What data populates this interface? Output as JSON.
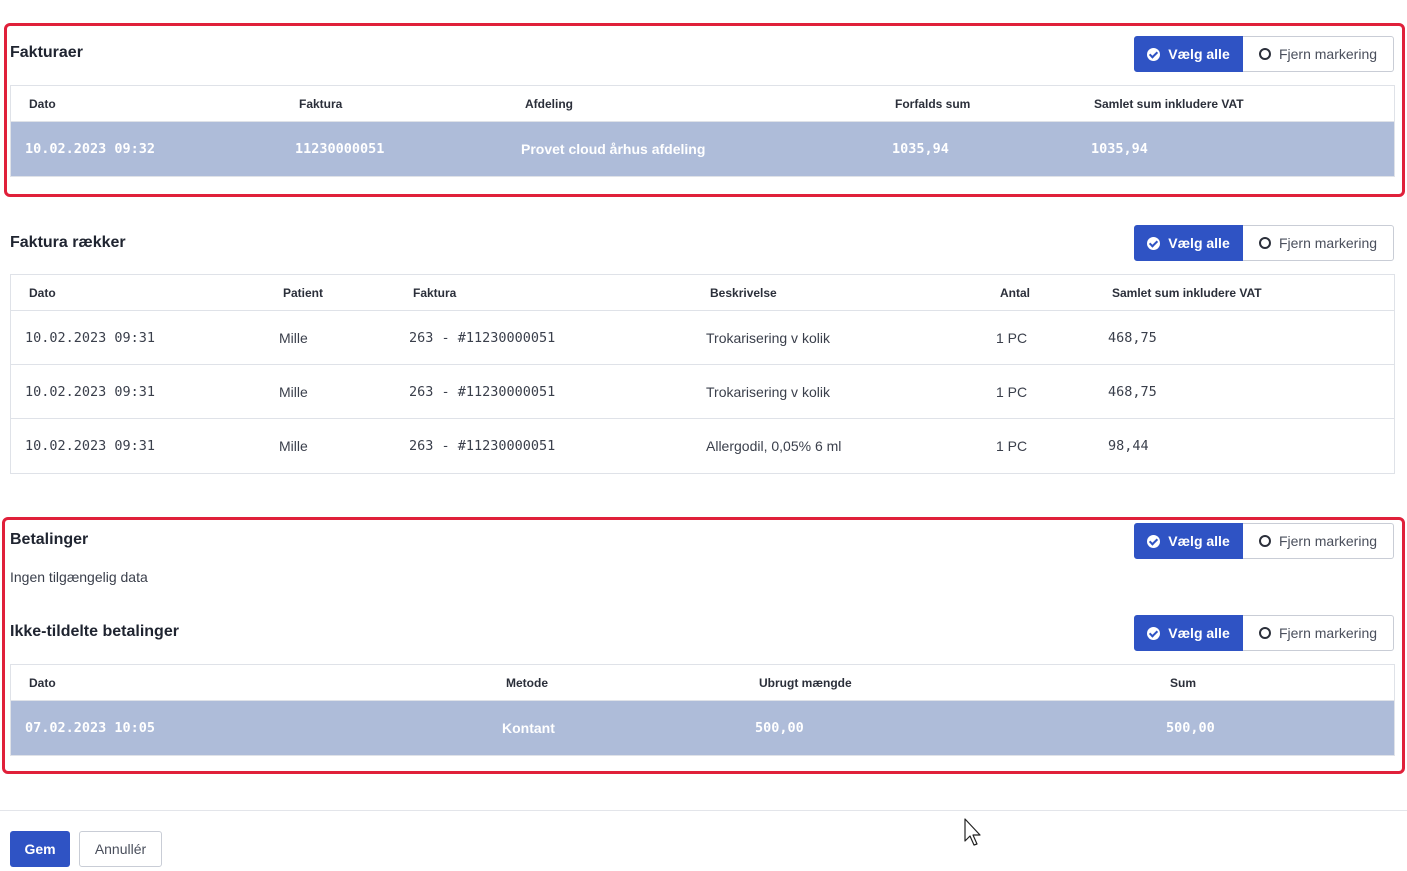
{
  "colors": {
    "accent": "#2f53c4",
    "highlight": "#e0203a",
    "selected_row": "#aebcd9"
  },
  "common": {
    "select_all": "Vælg alle",
    "clear_selection": "Fjern markering"
  },
  "invoices": {
    "title": "Fakturaer",
    "columns": [
      "Dato",
      "Faktura",
      "Afdeling",
      "Forfalds sum",
      "Samlet sum inkludere VAT"
    ],
    "rows": [
      [
        "10.02.2023 09:32",
        "11230000051",
        "Provet cloud århus afdeling",
        "1035,94",
        "1035,94"
      ]
    ]
  },
  "invoice_lines": {
    "title": "Faktura rækker",
    "columns": [
      "Dato",
      "Patient",
      "Faktura",
      "Beskrivelse",
      "Antal",
      "Samlet sum inkludere VAT"
    ],
    "rows": [
      [
        "10.02.2023 09:31",
        "Mille",
        "263 - #11230000051",
        "Trokarisering v kolik",
        "1 PC",
        "468,75"
      ],
      [
        "10.02.2023 09:31",
        "Mille",
        "263 - #11230000051",
        "Trokarisering v kolik",
        "1 PC",
        "468,75"
      ],
      [
        "10.02.2023 09:31",
        "Mille",
        "263 - #11230000051",
        "Allergodil, 0,05% 6 ml",
        "1 PC",
        "98,44"
      ]
    ]
  },
  "payments": {
    "title": "Betalinger",
    "empty_text": "Ingen tilgængelig data"
  },
  "unassigned": {
    "title": "Ikke-tildelte betalinger",
    "columns": [
      "Dato",
      "Metode",
      "Ubrugt mængde",
      "Sum"
    ],
    "rows": [
      [
        "07.02.2023 10:05",
        "Kontant",
        "500,00",
        "500,00"
      ]
    ]
  },
  "footer": {
    "save_label": "Gem",
    "cancel_label": "Annullér"
  }
}
